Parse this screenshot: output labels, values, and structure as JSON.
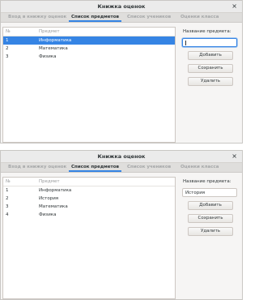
{
  "window1": {
    "title": "Книжка оценок",
    "close_glyph": "×",
    "tabs": [
      {
        "label": "Вход в книжку оценок"
      },
      {
        "label": "Список предметов"
      },
      {
        "label": "Список учеников"
      },
      {
        "label": "Оценки класса"
      }
    ],
    "active_tab": 1,
    "list": {
      "headers": {
        "num": "№",
        "subject": "Предмет"
      },
      "rows": [
        {
          "num": "1",
          "subject": "Информатика",
          "selected": true
        },
        {
          "num": "2",
          "subject": "Математика",
          "selected": false
        },
        {
          "num": "3",
          "subject": "Физика",
          "selected": false
        }
      ]
    },
    "side": {
      "label": "Название предмета:",
      "field_value": "",
      "add_label": "Добавить",
      "save_label": "Сохранить",
      "delete_label": "Удалить"
    }
  },
  "window2": {
    "title": "Книжка оценок",
    "close_glyph": "×",
    "tabs": [
      {
        "label": "Вход в книжку оценок"
      },
      {
        "label": "Список предметов"
      },
      {
        "label": "Список учеников"
      },
      {
        "label": "Оценки класса"
      }
    ],
    "active_tab": 1,
    "list": {
      "headers": {
        "num": "№",
        "subject": "Предмет"
      },
      "rows": [
        {
          "num": "1",
          "subject": "Информатика"
        },
        {
          "num": "2",
          "subject": "История"
        },
        {
          "num": "3",
          "subject": "Математика"
        },
        {
          "num": "4",
          "subject": "Физика"
        }
      ]
    },
    "side": {
      "label": "Название предмета:",
      "field_value": "История",
      "add_label": "Добавить",
      "save_label": "Сохранить",
      "delete_label": "Удалить"
    }
  },
  "colors": {
    "accent": "#3584e4",
    "window_bg": "#f6f5f4",
    "inactive_tab_text": "#a5a7a8"
  }
}
